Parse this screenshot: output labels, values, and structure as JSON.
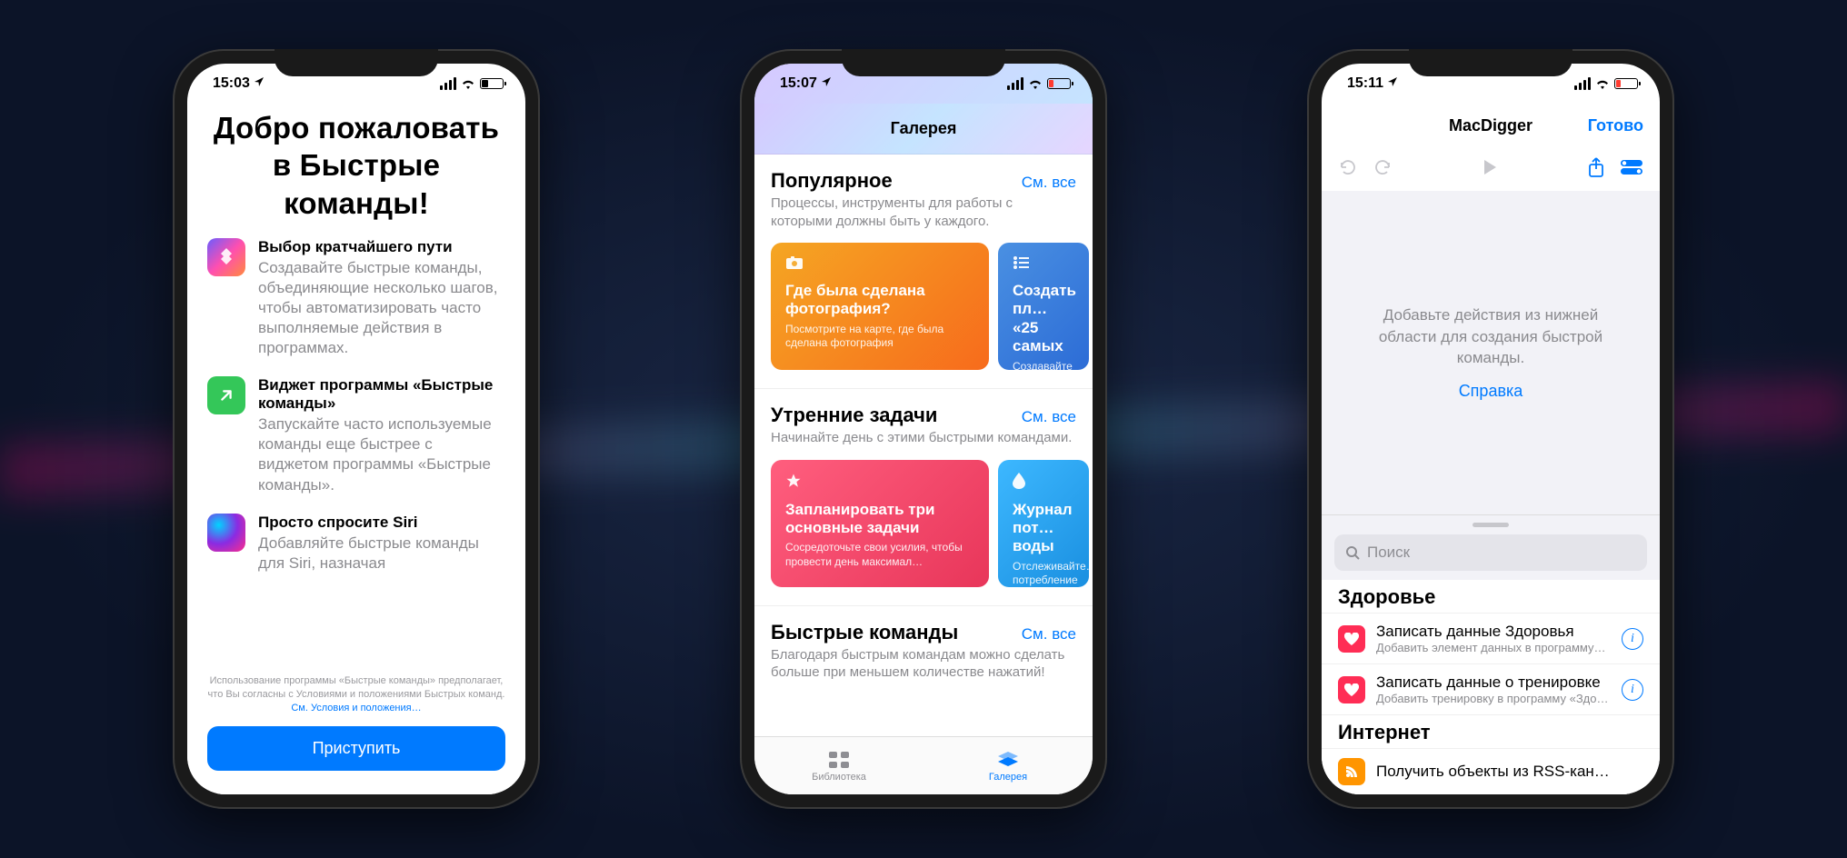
{
  "phones": {
    "p1": {
      "time": "15:03",
      "title": "Добро пожаловать в Быстрые команды!",
      "features": [
        {
          "heading": "Выбор кратчайшего пути",
          "body": "Создавайте быстрые команды, объединяющие несколько шагов, чтобы автоматизировать часто выполняемые действия в программах."
        },
        {
          "heading": "Виджет программы «Быстрые команды»",
          "body": "Запускайте часто используемые команды еще быстрее с виджетом программы «Быстрые команды»."
        },
        {
          "heading": "Просто спросите Siri",
          "body": "Добавляйте быстрые команды для Siri, назначая"
        }
      ],
      "terms": "Использование программы «Быстрые команды» предполагает, что Вы согласны с Условиями и положениями Быстрых команд.",
      "terms_link": "См. Условия и положения…",
      "cta": "Приступить"
    },
    "p2": {
      "time": "15:07",
      "header": "Галерея",
      "see_all": "См. все",
      "sections": [
        {
          "title": "Популярное",
          "subtitle": "Процессы, инструменты для работы с которыми должны быть у каждого.",
          "cards": [
            {
              "title": "Где была сделана фотография?",
              "sub": "Посмотрите на карте, где была сделана фотография",
              "icon": "camera"
            },
            {
              "title": "Создать пл… «25 самых",
              "sub": "Создавайте сп… прослушиваем…",
              "icon": "list"
            }
          ]
        },
        {
          "title": "Утренние задачи",
          "subtitle": "Начинайте день с этими быстрыми командами.",
          "cards": [
            {
              "title": "Запланировать три основные задачи",
              "sub": "Сосредоточьте свои усилия, чтобы провести день максимал…",
              "icon": "star"
            },
            {
              "title": "Журнал пот… воды",
              "sub": "Отслеживайте… потребление в…",
              "icon": "drop"
            }
          ]
        },
        {
          "title": "Быстрые команды",
          "subtitle": "Благодаря быстрым командам можно сделать больше при меньшем количестве нажатий!"
        }
      ],
      "tabs": {
        "library": "Библиотека",
        "gallery": "Галерея"
      }
    },
    "p3": {
      "time": "15:11",
      "title": "MacDigger",
      "done": "Готово",
      "hint": "Добавьте действия из нижней области для создания быстрой команды.",
      "help": "Справка",
      "search_placeholder": "Поиск",
      "cat_health": "Здоровье",
      "cat_internet": "Интернет",
      "items": [
        {
          "title": "Записать данные Здоровья",
          "sub": "Добавить элемент данных в программу…"
        },
        {
          "title": "Записать данные о тренировке",
          "sub": "Добавить тренировку в программу «Здо…"
        }
      ],
      "rss_item": {
        "title": "Получить объекты из RSS-кан…"
      }
    }
  }
}
